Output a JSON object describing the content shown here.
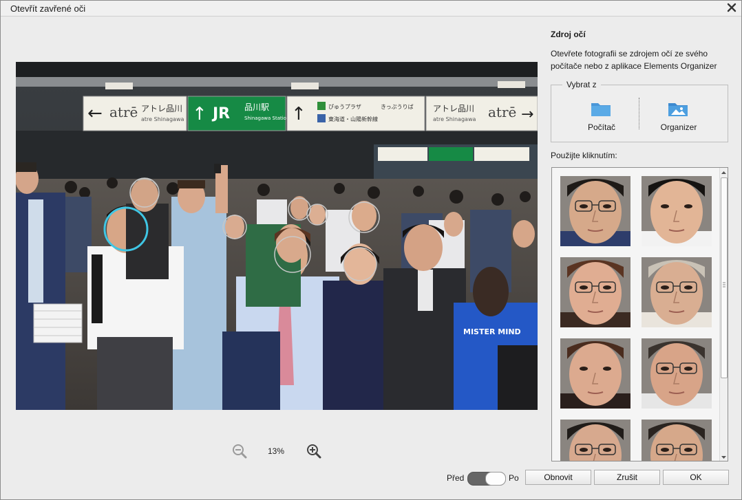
{
  "window": {
    "title": "Otevřít zavřené oči"
  },
  "photo": {
    "signs": {
      "left_brand": "atrē",
      "left_text": "アトレ品川",
      "left_sub": "atre Shinagawa",
      "jr_logo": "JR",
      "jr_station_jp": "品川駅",
      "jr_station_en": "Shinagawa Station",
      "mid_line1": "ぴゅうプラザ",
      "mid_line2": "きっぷうりば",
      "mid_line3": "東海道・山陽新幹線",
      "right_text": "アトレ品川",
      "right_brand": "atrē",
      "right_sub": "atre Shinagawa"
    },
    "shirt_text": "MISTER MIND"
  },
  "zoom": {
    "level": "13%"
  },
  "eye_source": {
    "title": "Zdroj očí",
    "description": "Otevřete fotografii se zdrojem očí ze svého počítače nebo z aplikace Elements Organizer",
    "select_from_label": "Vybrat z",
    "options": [
      {
        "label": "Počítač",
        "icon": "folder-icon"
      },
      {
        "label": "Organizer",
        "icon": "photo-folder-icon"
      }
    ]
  },
  "use_by_click_label": "Použijte kliknutím:",
  "thumbnails": [
    {
      "name": "face-thumb-1",
      "skin": "#d6a98a",
      "hair": "#1e1a17",
      "shirt": "#2e3d6b",
      "glasses": true
    },
    {
      "name": "face-thumb-2",
      "skin": "#e2b596",
      "hair": "#151311",
      "shirt": "#f2f2f2",
      "glasses": false
    },
    {
      "name": "face-thumb-3",
      "skin": "#e0ad92",
      "hair": "#5a3422",
      "shirt": "#3b2a22",
      "glasses": true
    },
    {
      "name": "face-thumb-4",
      "skin": "#d9ae92",
      "hair": "#c9c2b6",
      "shirt": "#e9e4dc",
      "glasses": true
    },
    {
      "name": "face-thumb-5",
      "skin": "#dcaa8f",
      "hair": "#4a2c1e",
      "shirt": "#2a1f1c",
      "glasses": false
    },
    {
      "name": "face-thumb-6",
      "skin": "#d8a488",
      "hair": "#3a332e",
      "shirt": "#e6e6e6",
      "glasses": true
    },
    {
      "name": "face-thumb-7",
      "skin": "#d7a98e",
      "hair": "#201c19",
      "shirt": "#eaeaea",
      "glasses": true
    },
    {
      "name": "face-thumb-8",
      "skin": "#d6a88a",
      "hair": "#2a2420",
      "shirt": "#d8d8d8",
      "glasses": true
    }
  ],
  "toggle": {
    "before_label": "Před",
    "after_label": "Po",
    "state": "after"
  },
  "buttons": {
    "reset": "Obnovit",
    "cancel": "Zrušit",
    "ok": "OK"
  },
  "colors": {
    "selected_face_ring": "#3fc6e4",
    "face_ring": "#c8c8c8"
  }
}
